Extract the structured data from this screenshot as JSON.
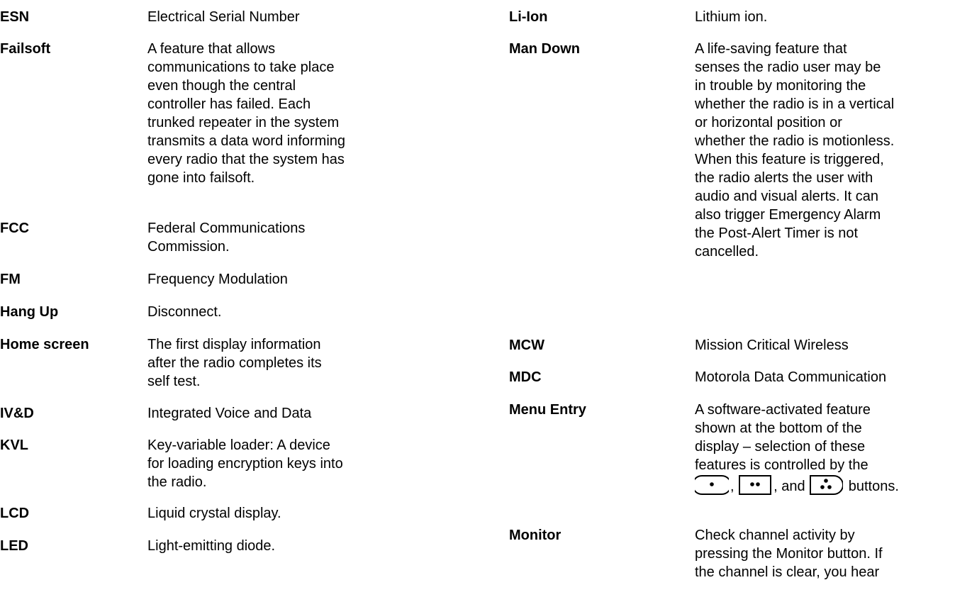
{
  "left_column": [
    {
      "term": "ESN",
      "lines": [
        "Electrical Serial Number"
      ]
    },
    {
      "term": "Failsoft",
      "lines": [
        "A feature that allows",
        "communications to take place",
        "even though the central",
        "controller has failed. Each",
        "trunked repeater in the system",
        "transmits a data word informing",
        "every radio that the system has",
        "gone into failsoft."
      ]
    },
    {
      "term": "FCC",
      "lines": [
        "Federal Communications",
        "Commission."
      ]
    },
    {
      "term": "FM",
      "lines": [
        "Frequency Modulation"
      ]
    },
    {
      "term": "Hang Up",
      "lines": [
        "Disconnect."
      ]
    },
    {
      "term": "Home screen",
      "lines": [
        "The first display information",
        "after the radio completes its",
        "self test."
      ]
    },
    {
      "term": "IV&D",
      "lines": [
        "Integrated Voice and Data"
      ]
    },
    {
      "term": "KVL",
      "lines": [
        "Key-variable loader: A device",
        "for loading encryption keys into",
        "the radio."
      ]
    },
    {
      "term": "LCD",
      "lines": [
        "Liquid crystal display."
      ]
    },
    {
      "term": "LED",
      "lines": [
        "Light-emitting diode."
      ]
    }
  ],
  "right_column": [
    {
      "term": "Li-Ion",
      "lines": [
        "Lithium ion."
      ]
    },
    {
      "term": "Man Down",
      "lines": [
        "A life-saving feature that",
        "senses the radio user may be",
        "in trouble by monitoring the",
        "whether the radio is in a vertical",
        "or horizontal position or",
        "whether the radio is motionless.",
        "When this feature is triggered,",
        "the radio alerts the user with",
        "audio and visual alerts. It can",
        "also trigger Emergency Alarm",
        "the Post-Alert Timer is not",
        "cancelled."
      ]
    },
    {
      "term": "MCW",
      "lines": [
        "Mission Critical Wireless"
      ]
    },
    {
      "term": "MDC",
      "lines": [
        "Motorola Data Communication"
      ]
    },
    {
      "term": "Menu Entry",
      "lines": [
        "A software-activated feature",
        "shown at the bottom of the",
        "display – selection of these",
        "features is controlled by the"
      ],
      "button_line": {
        "sep1": ",",
        "sep2": ", and",
        "tail": "buttons.",
        "icons": [
          "menu-select-button-1-icon",
          "menu-select-button-2-icon",
          "menu-select-button-3-icon"
        ]
      }
    },
    {
      "term": "Monitor",
      "lines": [
        "Check channel activity by",
        "pressing the Monitor button. If",
        "the channel is clear, you hear"
      ]
    }
  ]
}
